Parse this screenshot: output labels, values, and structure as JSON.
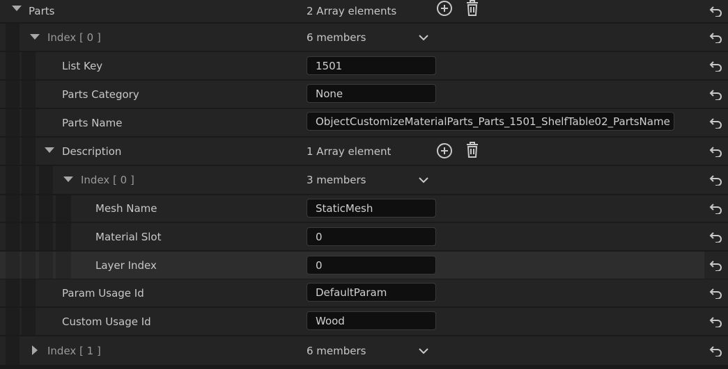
{
  "rows": {
    "parts": {
      "label": "Parts",
      "value": "2 Array elements"
    },
    "index0": {
      "label": "Index [ 0 ]",
      "value": "6 members"
    },
    "list_key": {
      "label": "List Key",
      "value": "1501"
    },
    "parts_category": {
      "label": "Parts Category",
      "value": "None"
    },
    "parts_name": {
      "label": "Parts Name",
      "value": "ObjectCustomizeMaterialParts_Parts_1501_ShelfTable02_PartsName"
    },
    "description": {
      "label": "Description",
      "value": "1 Array element"
    },
    "desc_index0": {
      "label": "Index [ 0 ]",
      "value": "3 members"
    },
    "mesh_name": {
      "label": "Mesh Name",
      "value": "StaticMesh"
    },
    "material_slot": {
      "label": "Material Slot",
      "value": "0"
    },
    "layer_index": {
      "label": "Layer Index",
      "value": "0"
    },
    "param_usage_id": {
      "label": "Param Usage Id",
      "value": "DefaultParam"
    },
    "custom_usage_id": {
      "label": "Custom Usage Id",
      "value": "Wood"
    },
    "index1": {
      "label": "Index [ 1 ]",
      "value": "6 members"
    }
  },
  "icons": {
    "expand": "triangle-down-icon",
    "collapse": "triangle-right-icon",
    "add": "plus-circle-icon",
    "delete": "trash-icon",
    "dropdown": "chevron-down-icon",
    "reset": "reset-arrow-icon"
  }
}
